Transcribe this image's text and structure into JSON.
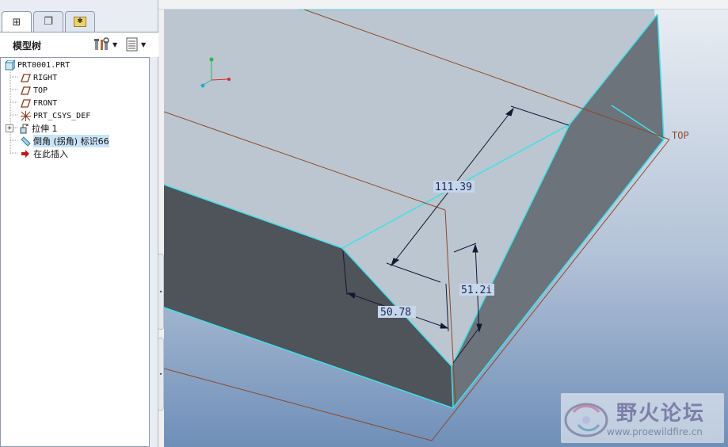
{
  "tabs": [
    {
      "name": "model-tree-tab",
      "icon": "tree-icon",
      "glyph": "⊞"
    },
    {
      "name": "layers-tab",
      "icon": "layers-icon",
      "glyph": "❐"
    },
    {
      "name": "favorites-tab",
      "icon": "folder-star-icon",
      "glyph": "✱"
    }
  ],
  "tree_header": {
    "title": "模型树",
    "tools_icon": "settings-tools-icon",
    "view_icon": "show-list-icon"
  },
  "tree": {
    "items": [
      {
        "label": "PRT0001.PRT",
        "icon": "part-icon"
      },
      {
        "label": "RIGHT",
        "icon": "datum-plane-icon"
      },
      {
        "label": "TOP",
        "icon": "datum-plane-icon"
      },
      {
        "label": "FRONT",
        "icon": "datum-plane-icon"
      },
      {
        "label": "PRT_CSYS_DEF",
        "icon": "coordinate-system-icon"
      },
      {
        "label": "拉伸 1",
        "icon": "extrude-icon",
        "expand": "+"
      },
      {
        "label": "倒角 (拐角) 标识66",
        "icon": "chamfer-icon",
        "selected": true
      },
      {
        "label": "在此插入",
        "icon": "insert-here-arrow-icon"
      }
    ]
  },
  "viewport": {
    "datum_label": "TOP",
    "dimensions": [
      "111.39",
      "51.2i",
      "50.78"
    ],
    "colors": {
      "bg_top": "#e8edf3",
      "bg_bottom": "#6f8fb8",
      "edge": "#40e0e8",
      "datum": "#8a4a2a"
    }
  },
  "watermark": {
    "title": "野火论坛",
    "url": "www.proewildfire.cn"
  }
}
